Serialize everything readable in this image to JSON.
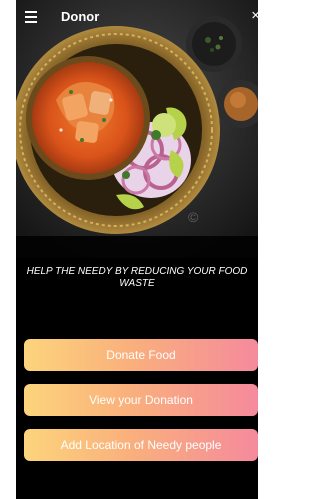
{
  "app_bar": {
    "title": "Donor",
    "menu_icon": "hamburger-menu-icon",
    "close_icon": "close-icon",
    "close_glyph": "×"
  },
  "hero": {
    "description": "food-photo"
  },
  "tagline": "HELP THE NEEDY BY REDUCING YOUR FOOD WASTE",
  "actions": {
    "donate_label": "Donate Food",
    "view_label": "View your Donation",
    "location_label": "Add Location of Needy people"
  },
  "colors": {
    "background": "#000000",
    "button_gradient_start": "#fdd47c",
    "button_gradient_end": "#f58a9c",
    "button_text": "#ffffff"
  }
}
